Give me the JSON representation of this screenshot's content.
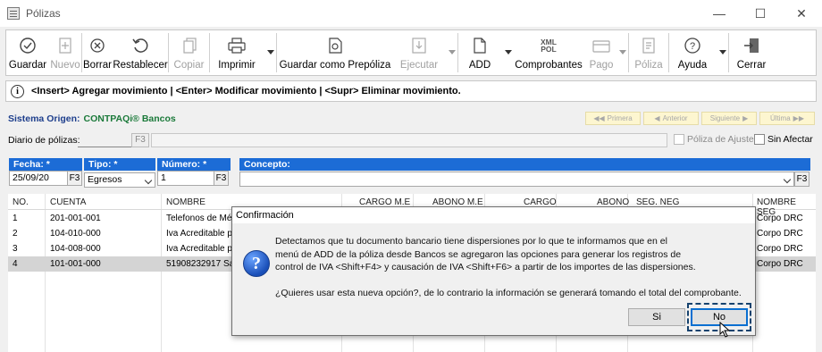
{
  "window": {
    "title": "Pólizas"
  },
  "toolbar": {
    "items": [
      {
        "label": "Guardar",
        "icon": "check-circle-icon",
        "enabled": true
      },
      {
        "label": "Nuevo",
        "icon": "new-document-icon",
        "enabled": false
      },
      {
        "label": "Borrar",
        "icon": "delete-circle-icon",
        "enabled": true
      },
      {
        "label": "Restablecer",
        "icon": "undo-icon",
        "enabled": true
      },
      {
        "label": "Copiar",
        "icon": "copy-icon",
        "enabled": false
      },
      {
        "label": "Imprimir",
        "icon": "printer-icon",
        "enabled": true
      },
      {
        "label": "Guardar como Prepóliza",
        "icon": "save-template-icon",
        "enabled": true
      },
      {
        "label": "Ejecutar",
        "icon": "execute-icon",
        "enabled": false
      },
      {
        "label": "ADD",
        "icon": "add-document-icon",
        "enabled": true
      },
      {
        "label": "Comprobantes",
        "icon": "xml-pol-icon",
        "enabled": true,
        "icon_text": [
          "XML",
          "POL"
        ]
      },
      {
        "label": "Pago",
        "icon": "payment-icon",
        "enabled": false
      },
      {
        "label": "Póliza",
        "icon": "policy-icon",
        "enabled": false
      },
      {
        "label": "Ayuda",
        "icon": "help-icon",
        "enabled": true
      },
      {
        "label": "Cerrar",
        "icon": "exit-icon",
        "enabled": true
      }
    ]
  },
  "infobar": {
    "text": "<Insert> Agregar movimiento | <Enter> Modificar movimiento | <Supr> Eliminar movimiento."
  },
  "origin": {
    "label": "Sistema Origen:",
    "value": "CONTPAQi® Bancos"
  },
  "nav": {
    "first": "Primera",
    "prev": "Anterior",
    "next": "Siguiente",
    "last": "Última"
  },
  "diario": {
    "label": "Diario de pólizas:",
    "f3": "F3",
    "poliza_ajuste": "Póliza de Ajuste",
    "sin_afectar": "Sin Afectar"
  },
  "form": {
    "fecha_label": "Fecha: *",
    "fecha_value": "25/09/20",
    "fecha_f3": "F3",
    "tipo_label": "Tipo: *",
    "tipo_value": "Egresos",
    "numero_label": "Número: *",
    "numero_value": "1",
    "numero_f3": "F3",
    "concepto_label": "Concepto:",
    "concepto_value": "",
    "concepto_f3": "F3"
  },
  "grid": {
    "columns": [
      "NO.",
      "CUENTA",
      "NOMBRE",
      "CARGO M.E",
      "ABONO M.E",
      "CARGO",
      "ABONO",
      "SEG. NEG",
      "NOMBRE SEG"
    ],
    "rows": [
      {
        "no": "1",
        "cuenta": "201-001-001",
        "nombre": "Telefonos de Més",
        "seg": "Corpo DRC"
      },
      {
        "no": "2",
        "cuenta": "104-010-000",
        "nombre": "Iva Acreditable p",
        "seg": "Corpo DRC"
      },
      {
        "no": "3",
        "cuenta": "104-008-000",
        "nombre": "Iva Acreditable p",
        "seg": "Corpo DRC"
      },
      {
        "no": "4",
        "cuenta": "101-001-000",
        "nombre": "51908232917 Sa",
        "seg": "Corpo DRC"
      }
    ],
    "selected_row": 4
  },
  "dialog": {
    "title": "Confirmación",
    "icon": "question-icon",
    "message_lines": [
      "Detectamos que tu documento bancario tiene dispersiones por lo que te informamos que en el",
      "menú de ADD de la póliza desde Bancos se agregaron las opciones para generar los registros de",
      "control de IVA <Shift+F4> y causación de IVA <Shift+F6> a partir de los importes de las dispersiones."
    ],
    "question": "¿Quieres usar esta nueva opción?, de lo contrario la información se generará tomando el total del comprobante.",
    "yes_label": "Si",
    "no_label": "No"
  },
  "colors": {
    "header_blue": "#1c6cd6",
    "origin_label": "#1d3e8c",
    "origin_value": "#1b7a3a",
    "nav_bg": "#fdf6d0"
  }
}
